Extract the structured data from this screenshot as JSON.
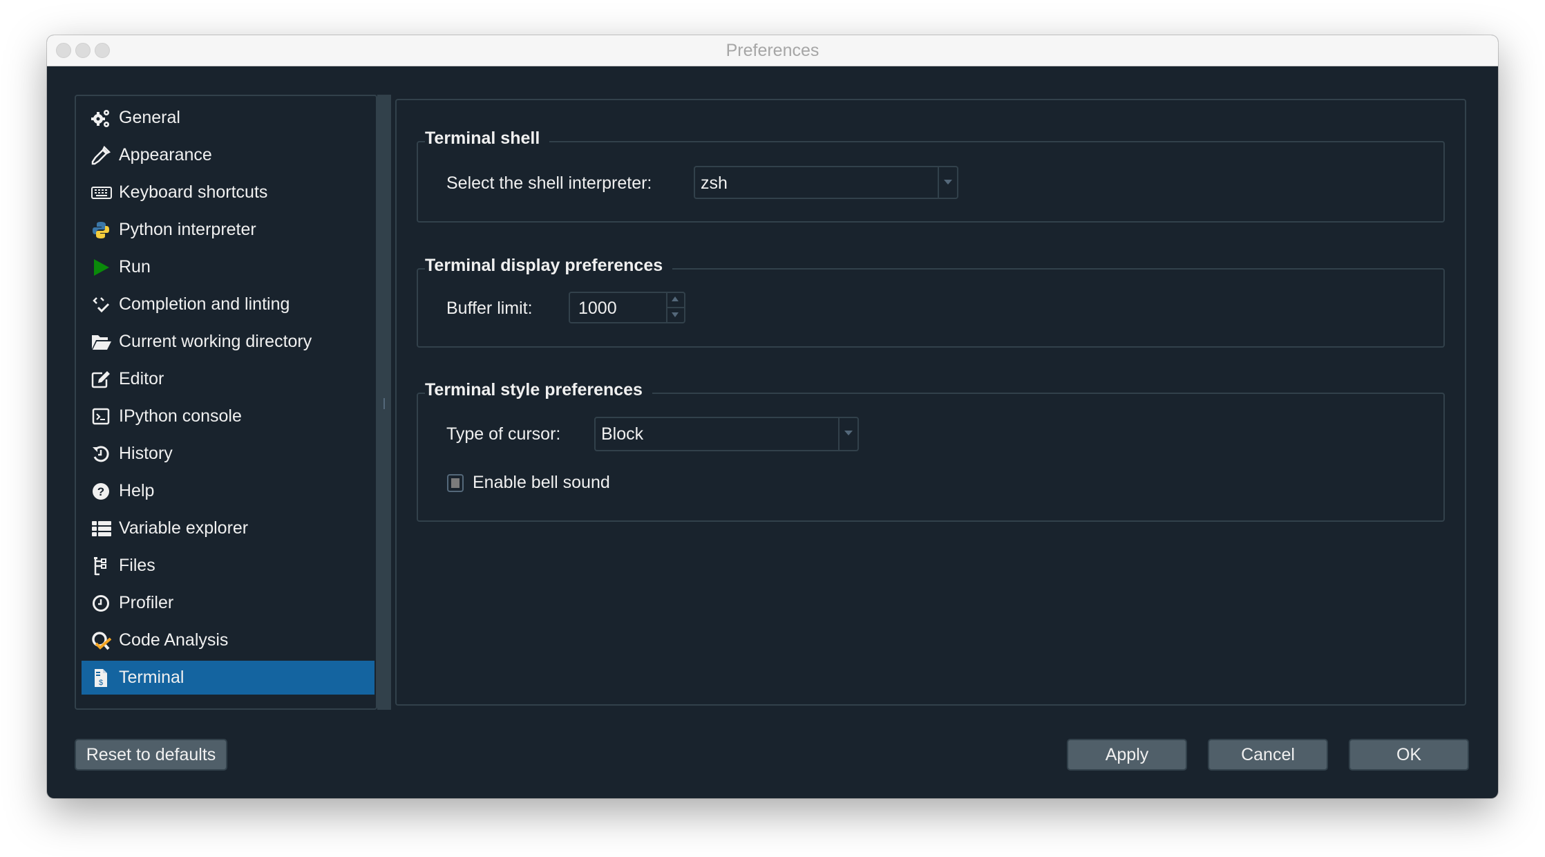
{
  "window": {
    "title": "Preferences"
  },
  "sidebar": {
    "items": [
      {
        "label": "General",
        "icon": "gears-icon"
      },
      {
        "label": "Appearance",
        "icon": "eyedropper-icon"
      },
      {
        "label": "Keyboard shortcuts",
        "icon": "keyboard-icon"
      },
      {
        "label": "Python interpreter",
        "icon": "python-icon"
      },
      {
        "label": "Run",
        "icon": "play-icon"
      },
      {
        "label": "Completion and linting",
        "icon": "code-check-icon"
      },
      {
        "label": "Current working directory",
        "icon": "folder-open-icon"
      },
      {
        "label": "Editor",
        "icon": "edit-icon"
      },
      {
        "label": "IPython console",
        "icon": "terminal-prompt-icon"
      },
      {
        "label": "History",
        "icon": "history-icon"
      },
      {
        "label": "Help",
        "icon": "question-circle-icon"
      },
      {
        "label": "Variable explorer",
        "icon": "table-list-icon"
      },
      {
        "label": "Files",
        "icon": "file-tree-icon"
      },
      {
        "label": "Profiler",
        "icon": "clock-icon"
      },
      {
        "label": "Code Analysis",
        "icon": "magnifier-check-icon"
      },
      {
        "label": "Terminal",
        "icon": "terminal-file-icon",
        "selected": true
      }
    ],
    "selected_index": 15
  },
  "terminal_shell": {
    "title": "Terminal shell",
    "shell_label": "Select the shell interpreter:",
    "shell_value": "zsh"
  },
  "terminal_display": {
    "title": "Terminal display preferences",
    "buffer_label": "Buffer limit:",
    "buffer_value": "1000"
  },
  "terminal_style": {
    "title": "Terminal style preferences",
    "cursor_label": "Type of cursor:",
    "cursor_value": "Block",
    "bell_label": "Enable bell sound",
    "bell_checked": false
  },
  "footer": {
    "reset_label": "Reset to defaults",
    "apply_label": "Apply",
    "cancel_label": "Cancel",
    "ok_label": "OK"
  },
  "colors": {
    "background": "#19232d",
    "border": "#32414b",
    "selection": "#1464a0",
    "button": "#505f69",
    "text": "#f0f0f0",
    "run_green": "#0a8a0a",
    "analysis_orange": "#f5a623"
  }
}
